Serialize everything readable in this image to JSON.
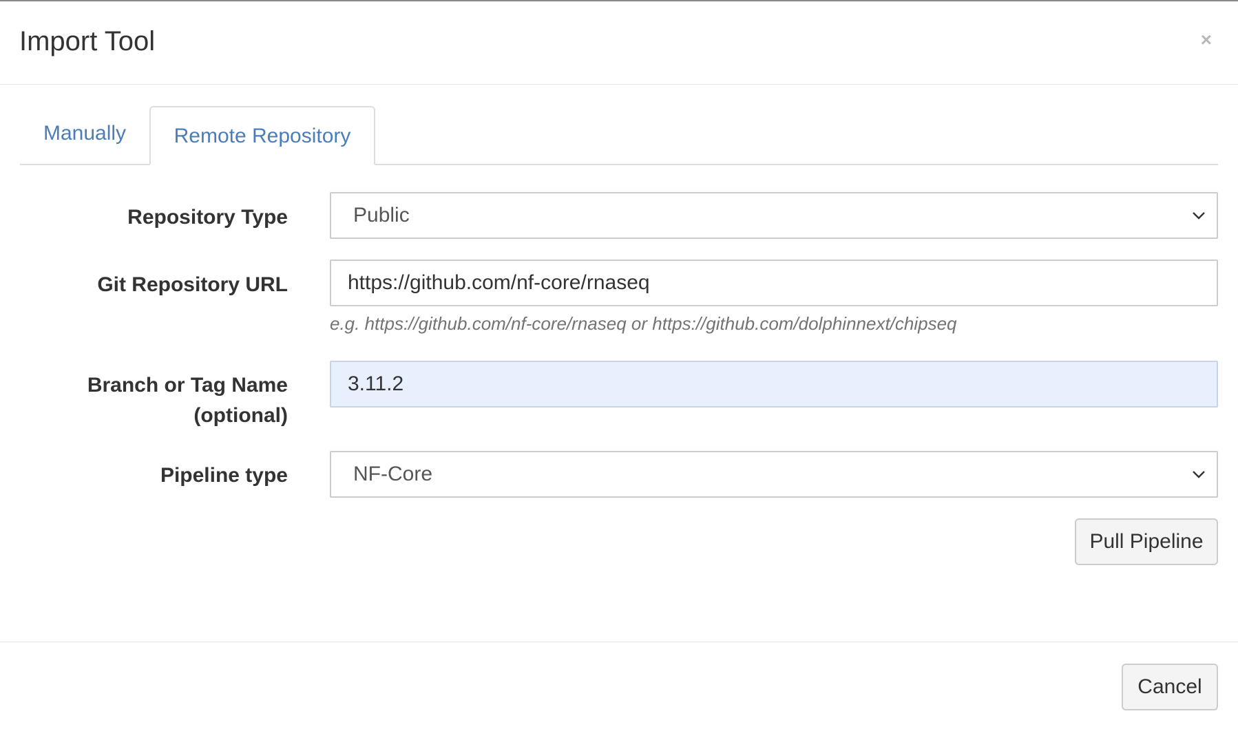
{
  "modal": {
    "title": "Import Tool",
    "close_glyph": "×"
  },
  "tabs": [
    {
      "label": "Manually",
      "active": false
    },
    {
      "label": "Remote Repository",
      "active": true
    }
  ],
  "form": {
    "repository_type": {
      "label": "Repository Type",
      "value": "Public"
    },
    "git_url": {
      "label": "Git Repository URL",
      "value": "https://github.com/nf-core/rnaseq",
      "help": "e.g. https://github.com/nf-core/rnaseq or https://github.com/dolphinnext/chipseq"
    },
    "branch": {
      "label_line1": "Branch or Tag Name",
      "label_line2": "(optional)",
      "value": "3.11.2"
    },
    "pipeline_type": {
      "label": "Pipeline type",
      "value": "NF-Core"
    }
  },
  "buttons": {
    "pull": "Pull Pipeline",
    "cancel": "Cancel"
  },
  "colors": {
    "tab_link": "#4a7dba",
    "autofill_bg": "#e8f0fe",
    "border": "#cccccc"
  },
  "icons": {
    "close": "close-icon",
    "select_arrow": "chevron-down-icon"
  }
}
